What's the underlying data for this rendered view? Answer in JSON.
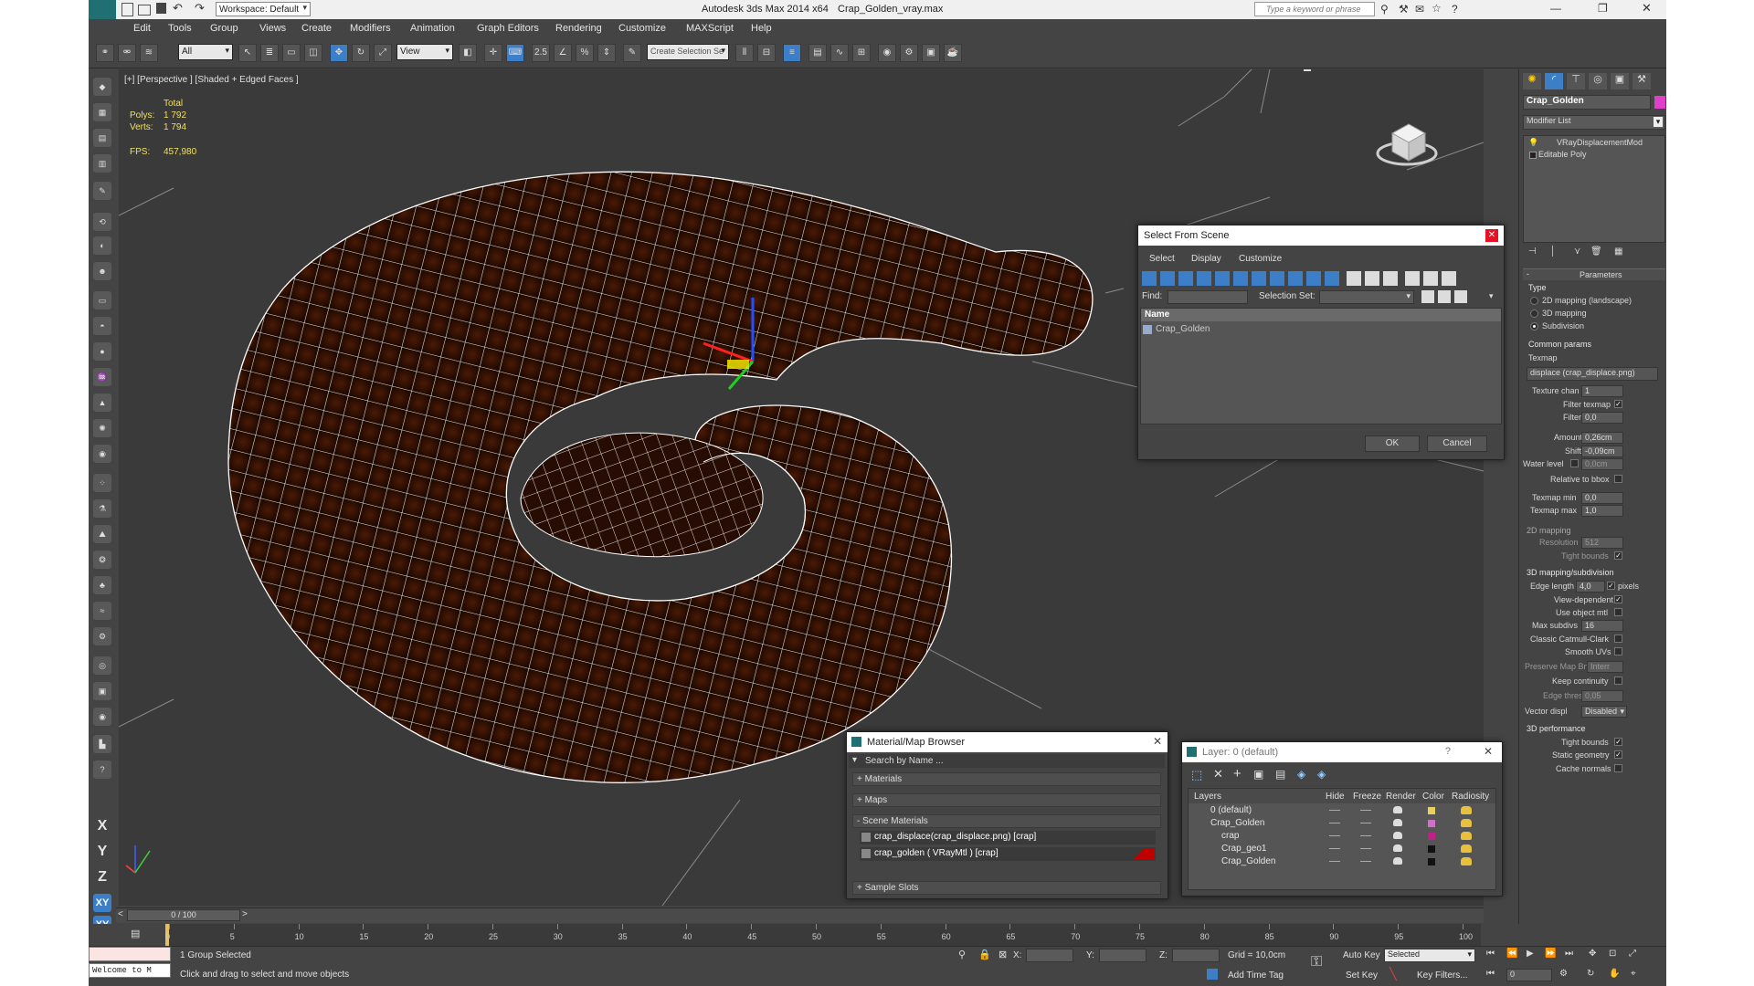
{
  "titlebar": {
    "workspace": "Workspace: Default",
    "app_title": "Autodesk 3ds Max  2014 x64",
    "file_name": "Crap_Golden_vray.max",
    "search_placeholder": "Type a keyword or phrase"
  },
  "menu": [
    "Edit",
    "Tools",
    "Group",
    "Views",
    "Create",
    "Modifiers",
    "Animation",
    "Graph Editors",
    "Rendering",
    "Customize",
    "MAXScript",
    "Help"
  ],
  "toolbar": {
    "filter_value": "All",
    "ref_coord_value": "View",
    "selection_set_placeholder": "Create Selection Se",
    "snap_label": "2.5",
    "percent_label": "%"
  },
  "viewport": {
    "label": "[+] [Perspective ] [Shaded + Edged Faces ]",
    "stats_total": "Total",
    "polys_label": "Polys:",
    "polys_value": "1 792",
    "verts_label": "Verts:",
    "verts_value": "1 794",
    "fps_label": "FPS:",
    "fps_value": "457,980",
    "mesh_color": "#3a1404",
    "wire_color": "#ffffff"
  },
  "left_tools_bottom": [
    "X",
    "Y",
    "Z",
    "XY",
    "XY"
  ],
  "select_from_scene": {
    "title": "Select From Scene",
    "menus": [
      "Select",
      "Display",
      "Customize"
    ],
    "find_label": "Find:",
    "selection_set_label": "Selection Set:",
    "column_name": "Name",
    "items": [
      "Crap_Golden"
    ],
    "ok": "OK",
    "cancel": "Cancel"
  },
  "material_browser": {
    "title": "Material/Map Browser",
    "search_placeholder": "Search by Name ...",
    "groups": [
      "+ Materials",
      "+ Maps",
      "- Scene Materials",
      "+ Sample Slots"
    ],
    "scene_materials": [
      "crap_displace(crap_displace.png) [crap]",
      "crap_golden ( VRayMtl ) [crap]"
    ]
  },
  "layer_dialog": {
    "title": "Layer: 0 (default)",
    "help": "?",
    "columns": [
      "Layers",
      "Hide",
      "Freeze",
      "Render",
      "Color",
      "Radiosity"
    ],
    "rows": [
      {
        "name": "0 (default)",
        "indent": 0,
        "color": "#e8d060"
      },
      {
        "name": "Crap_Golden",
        "indent": 0,
        "color": "#d070c8"
      },
      {
        "name": "crap",
        "indent": 1,
        "color": "#c0208a"
      },
      {
        "name": "Crap_geo1",
        "indent": 1,
        "color": "#111111"
      },
      {
        "name": "Crap_Golden",
        "indent": 1,
        "color": "#111111"
      }
    ]
  },
  "command_panel": {
    "object_name": "Crap_Golden",
    "object_color": "#e040c8",
    "modifier_list": "Modifier List",
    "stack": [
      "VRayDisplacementMod",
      "Editable Poly"
    ],
    "rollout_title": "Parameters",
    "type_label": "Type",
    "type_options": [
      "2D mapping (landscape)",
      "3D mapping",
      "Subdivision"
    ],
    "common_params": "Common params",
    "texmap_label": "Texmap",
    "texmap_value": "displace (crap_displace.png)",
    "texture_chan_label": "Texture chan",
    "texture_chan_value": "1",
    "filter_texmap_label": "Filter texmap",
    "filter_blur_label": "Filter blur",
    "filter_blur_value": "0,0",
    "amount_label": "Amount",
    "amount_value": "0,26cm",
    "shift_label": "Shift",
    "shift_value": "-0,09cm",
    "water_level_label": "Water level",
    "water_level_value": "0,0cm",
    "relative_bbox_label": "Relative to bbox",
    "texmap_min_label": "Texmap min",
    "texmap_min_value": "0,0",
    "texmap_max_label": "Texmap max",
    "texmap_max_value": "1,0",
    "mapping2d_label": "2D mapping",
    "resolution_label": "Resolution",
    "resolution_value": "512",
    "tight_bounds_label": "Tight bounds",
    "mapping3d_label": "3D mapping/subdivision",
    "edge_length_label": "Edge length",
    "edge_length_value": "4,0",
    "pixels_label": "pixels",
    "view_dependent_label": "View-dependent",
    "use_object_mtl_label": "Use object mtl",
    "max_subdivs_label": "Max subdivs",
    "max_subdivs_value": "16",
    "classic_catmull_label": "Classic Catmull-Clark",
    "smooth_uvs_label": "Smooth UVs",
    "preserve_map_label": "Preserve Map Bnd",
    "preserve_map_value": "Interr",
    "keep_continuity_label": "Keep continuity",
    "edge_thresh_label": "Edge thresh",
    "edge_thresh_value": "0,05",
    "vector_displ_label": "Vector displ",
    "vector_displ_value": "Disabled",
    "perf_label": "3D performance",
    "tight_bounds2_label": "Tight bounds",
    "static_geometry_label": "Static geometry",
    "cache_normals_label": "Cache normals"
  },
  "timeline": {
    "frame_label": "0 / 100",
    "ticks": [
      "0",
      "5",
      "10",
      "15",
      "20",
      "25",
      "30",
      "35",
      "40",
      "45",
      "50",
      "55",
      "60",
      "65",
      "70",
      "75",
      "80",
      "85",
      "90",
      "95",
      "100"
    ]
  },
  "status": {
    "welcome": "Welcome to M",
    "selection_info": "1 Group Selected",
    "prompt": "Click and drag to select and move objects",
    "x_label": "X:",
    "y_label": "Y:",
    "z_label": "Z:",
    "grid": "Grid = 10,0cm",
    "auto_key": "Auto Key",
    "set_key": "Set Key",
    "selected_value": "Selected",
    "key_filters": "Key Filters...",
    "add_time_tag": "Add Time Tag",
    "frame_value": "0"
  }
}
